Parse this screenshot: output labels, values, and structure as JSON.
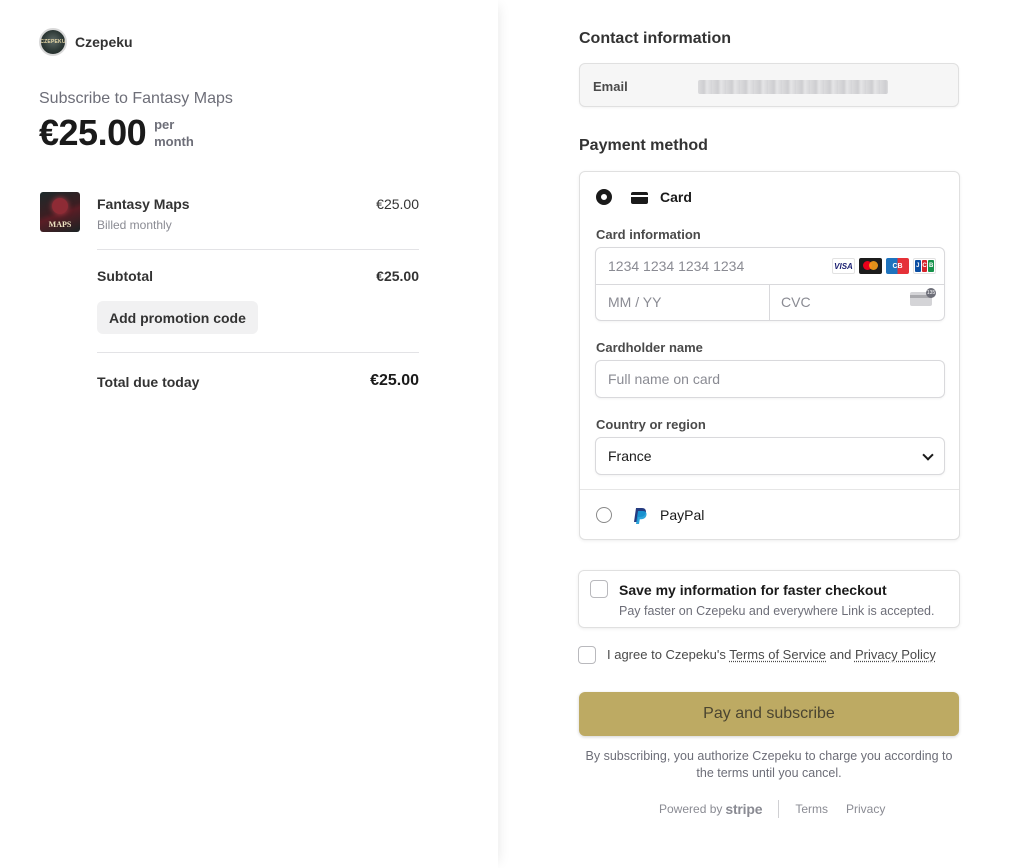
{
  "brand": {
    "name": "Czepeku",
    "logo_text": "CZEPEKU"
  },
  "summary": {
    "subscribe_title": "Subscribe to Fantasy Maps",
    "price": "€25.00",
    "price_unit": "per month",
    "item": {
      "name": "Fantasy Maps",
      "billing": "Billed monthly",
      "price": "€25.00",
      "thumb_text": "MAPS"
    },
    "subtotal_label": "Subtotal",
    "subtotal_value": "€25.00",
    "promo_label": "Add promotion code",
    "total_label": "Total due today",
    "total_value": "€25.00"
  },
  "contact": {
    "title": "Contact information",
    "email_label": "Email"
  },
  "payment": {
    "title": "Payment method",
    "card_label": "Card",
    "card_info_label": "Card information",
    "card_number_placeholder": "1234 1234 1234 1234",
    "expiry_placeholder": "MM / YY",
    "cvc_placeholder": "CVC",
    "card_brands": [
      "VISA",
      "Mastercard",
      "CB",
      "JCB"
    ],
    "cvc_hint": "135",
    "cardholder_label": "Cardholder name",
    "cardholder_placeholder": "Full name on card",
    "country_label": "Country or region",
    "country_value": "France",
    "paypal_label": "PayPal"
  },
  "save": {
    "title": "Save my information for faster checkout",
    "subtitle": "Pay faster on Czepeku and everywhere Link is accepted."
  },
  "agree": {
    "prefix": "I agree to Czepeku's",
    "terms": "Terms of Service",
    "and": "and",
    "privacy": "Privacy Policy"
  },
  "pay_button": "Pay and subscribe",
  "legal": "By subscribing, you authorize Czepeku to charge you according to the terms until you cancel.",
  "footer": {
    "powered": "Powered by",
    "stripe": "stripe",
    "terms": "Terms",
    "privacy": "Privacy"
  },
  "colors": {
    "accent": "#bdaa63",
    "text": "#1a1a1a",
    "muted": "#6d6e78"
  }
}
